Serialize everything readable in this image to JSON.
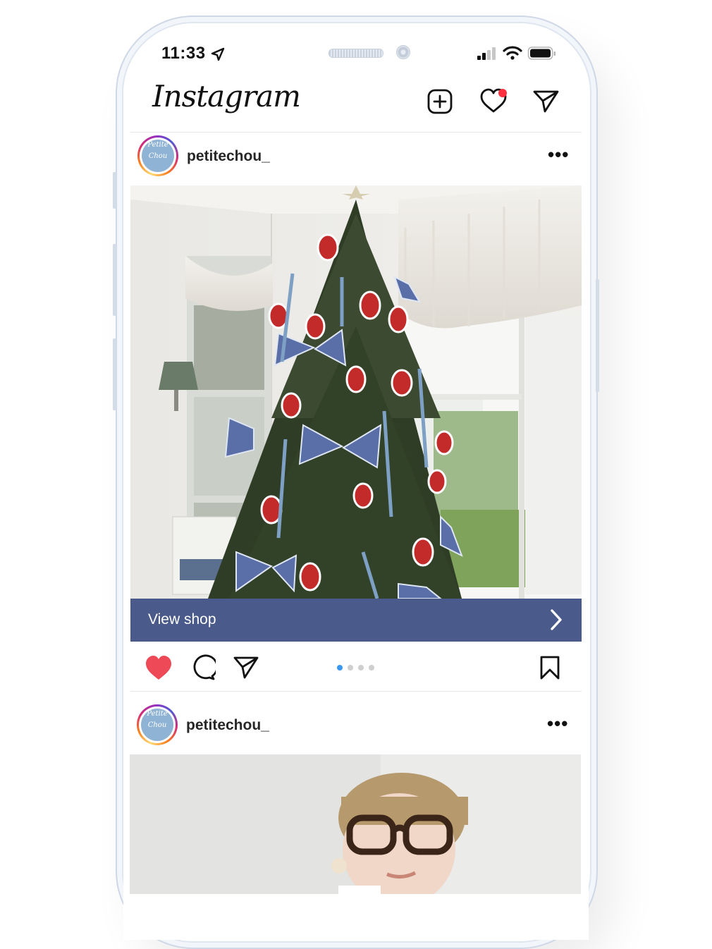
{
  "status_bar": {
    "time": "11:33"
  },
  "header": {
    "logo_text": "Instagram"
  },
  "posts": [
    {
      "username": "petitechou_",
      "avatar_text": "Petite Chou",
      "shop_label": "View shop",
      "liked": true,
      "carousel": {
        "count": 4,
        "active_index": 0
      }
    },
    {
      "username": "petitechou_",
      "avatar_text": "Petite Chou"
    }
  ],
  "colors": {
    "like_red": "#ed4956",
    "shop_bar": "#4a5a8a",
    "carousel_active": "#3897f0",
    "notification_dot": "#ff3040"
  },
  "icons": [
    "location-arrow-icon",
    "signal-icon",
    "wifi-icon",
    "battery-icon",
    "new-post-icon",
    "heart-icon",
    "direct-message-icon",
    "more-icon",
    "chevron-right-icon",
    "comment-icon",
    "share-icon",
    "bookmark-icon"
  ]
}
